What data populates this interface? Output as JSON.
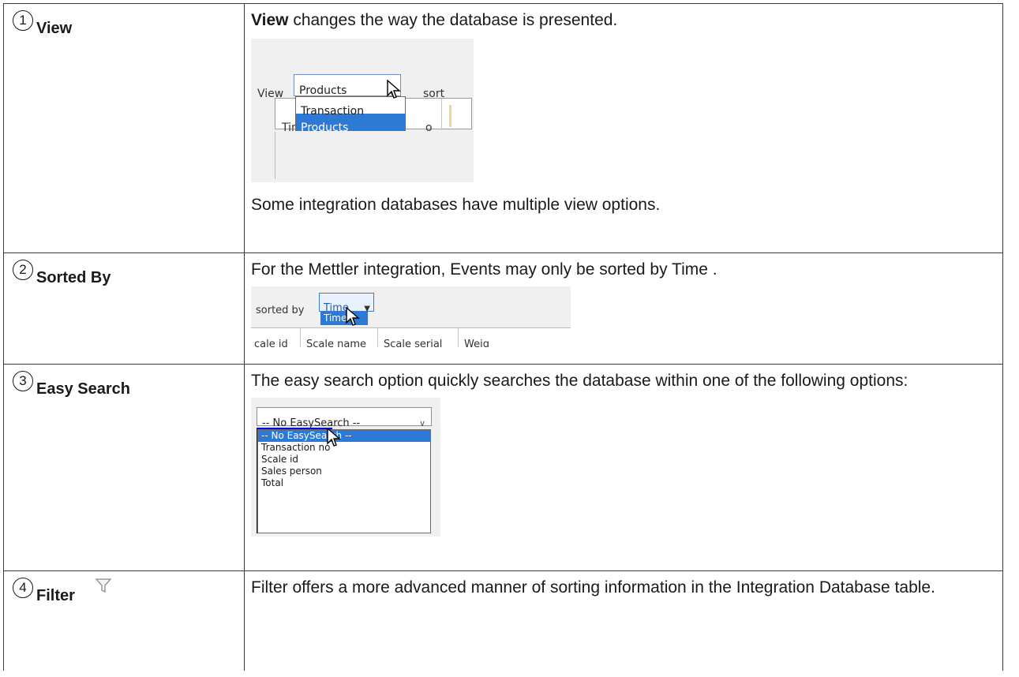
{
  "rows": [
    {
      "number": "1",
      "term": "View",
      "text_bold": "View",
      "text_rest": " changes the way the database is presented.",
      "screenshot": {
        "label": "View",
        "selected": "Products",
        "sort_label": "sort",
        "options": [
          "Transaction",
          "Products"
        ],
        "col_left": "Time",
        "col_right": "o"
      },
      "note": "Some integration databases have multiple view options."
    },
    {
      "number": "2",
      "term": "Sorted By",
      "text": "For the Mettler integration, Events may only be sorted by Time .",
      "screenshot": {
        "label": "sorted by",
        "selected": "Time",
        "option": "Time",
        "columns": [
          "cale id",
          "Scale name",
          "Scale serial",
          "Weig"
        ]
      }
    },
    {
      "number": "3",
      "term": "Easy Search",
      "text": "The easy search option quickly searches the database within one of the following options:",
      "screenshot": {
        "selected": "-- No EasySearch --",
        "options": [
          "-- No EasySearch --",
          "Transaction no",
          "Scale id",
          "Sales person",
          "Total"
        ]
      }
    },
    {
      "number": "4",
      "term": "Filter",
      "icon": "filter-funnel-icon",
      "text": "Filter offers a more advanced manner of sorting information in the Integration Database table."
    }
  ],
  "colors": {
    "border": "#3a3a3a",
    "selection": "#2d7ad6",
    "easysearch_block": "#0000ee"
  }
}
